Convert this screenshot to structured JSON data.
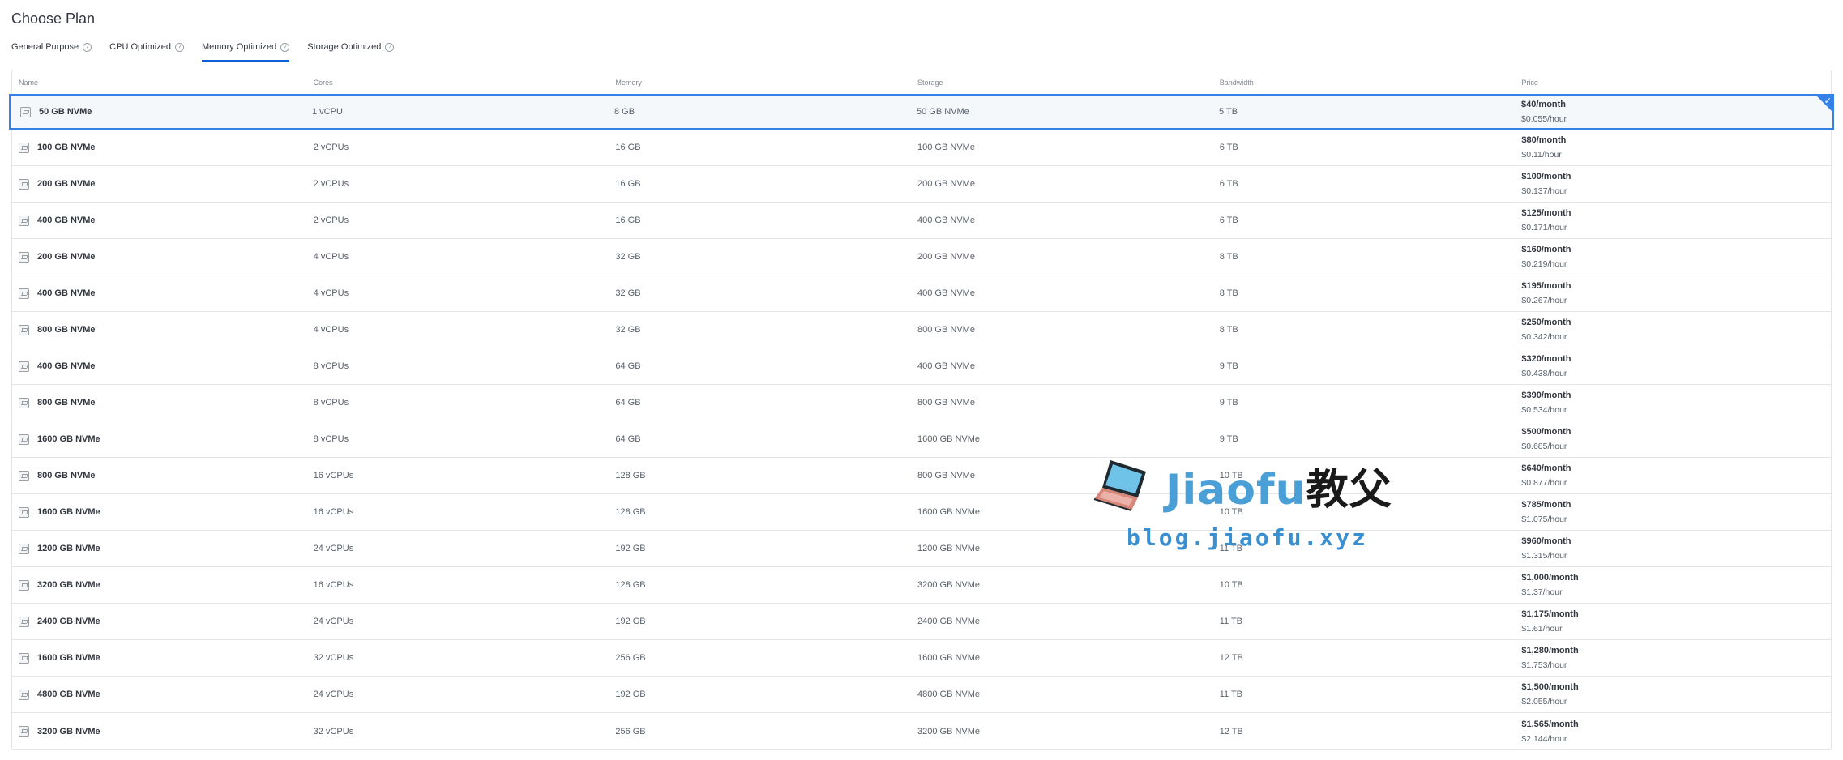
{
  "page": {
    "title": "Choose Plan"
  },
  "tabs": [
    {
      "label": "General Purpose",
      "active": false
    },
    {
      "label": "CPU Optimized",
      "active": false
    },
    {
      "label": "Memory Optimized",
      "active": true
    },
    {
      "label": "Storage Optimized",
      "active": false
    }
  ],
  "table": {
    "headers": {
      "name": "Name",
      "cores": "Cores",
      "memory": "Memory",
      "storage": "Storage",
      "bandwidth": "Bandwidth",
      "price": "Price"
    },
    "selected_index": 0,
    "rows": [
      {
        "name": "50 GB NVMe",
        "cores": "1 vCPU",
        "memory": "8 GB",
        "storage": "50 GB NVMe",
        "bandwidth": "5 TB",
        "price_month": "$40/month",
        "price_hour": "$0.055/hour"
      },
      {
        "name": "100 GB NVMe",
        "cores": "2 vCPUs",
        "memory": "16 GB",
        "storage": "100 GB NVMe",
        "bandwidth": "6 TB",
        "price_month": "$80/month",
        "price_hour": "$0.11/hour"
      },
      {
        "name": "200 GB NVMe",
        "cores": "2 vCPUs",
        "memory": "16 GB",
        "storage": "200 GB NVMe",
        "bandwidth": "6 TB",
        "price_month": "$100/month",
        "price_hour": "$0.137/hour"
      },
      {
        "name": "400 GB NVMe",
        "cores": "2 vCPUs",
        "memory": "16 GB",
        "storage": "400 GB NVMe",
        "bandwidth": "6 TB",
        "price_month": "$125/month",
        "price_hour": "$0.171/hour"
      },
      {
        "name": "200 GB NVMe",
        "cores": "4 vCPUs",
        "memory": "32 GB",
        "storage": "200 GB NVMe",
        "bandwidth": "8 TB",
        "price_month": "$160/month",
        "price_hour": "$0.219/hour"
      },
      {
        "name": "400 GB NVMe",
        "cores": "4 vCPUs",
        "memory": "32 GB",
        "storage": "400 GB NVMe",
        "bandwidth": "8 TB",
        "price_month": "$195/month",
        "price_hour": "$0.267/hour"
      },
      {
        "name": "800 GB NVMe",
        "cores": "4 vCPUs",
        "memory": "32 GB",
        "storage": "800 GB NVMe",
        "bandwidth": "8 TB",
        "price_month": "$250/month",
        "price_hour": "$0.342/hour"
      },
      {
        "name": "400 GB NVMe",
        "cores": "8 vCPUs",
        "memory": "64 GB",
        "storage": "400 GB NVMe",
        "bandwidth": "9 TB",
        "price_month": "$320/month",
        "price_hour": "$0.438/hour"
      },
      {
        "name": "800 GB NVMe",
        "cores": "8 vCPUs",
        "memory": "64 GB",
        "storage": "800 GB NVMe",
        "bandwidth": "9 TB",
        "price_month": "$390/month",
        "price_hour": "$0.534/hour"
      },
      {
        "name": "1600 GB NVMe",
        "cores": "8 vCPUs",
        "memory": "64 GB",
        "storage": "1600 GB NVMe",
        "bandwidth": "9 TB",
        "price_month": "$500/month",
        "price_hour": "$0.685/hour"
      },
      {
        "name": "800 GB NVMe",
        "cores": "16 vCPUs",
        "memory": "128 GB",
        "storage": "800 GB NVMe",
        "bandwidth": "10 TB",
        "price_month": "$640/month",
        "price_hour": "$0.877/hour"
      },
      {
        "name": "1600 GB NVMe",
        "cores": "16 vCPUs",
        "memory": "128 GB",
        "storage": "1600 GB NVMe",
        "bandwidth": "10 TB",
        "price_month": "$785/month",
        "price_hour": "$1.075/hour"
      },
      {
        "name": "1200 GB NVMe",
        "cores": "24 vCPUs",
        "memory": "192 GB",
        "storage": "1200 GB NVMe",
        "bandwidth": "11 TB",
        "price_month": "$960/month",
        "price_hour": "$1.315/hour"
      },
      {
        "name": "3200 GB NVMe",
        "cores": "16 vCPUs",
        "memory": "128 GB",
        "storage": "3200 GB NVMe",
        "bandwidth": "10 TB",
        "price_month": "$1,000/month",
        "price_hour": "$1.37/hour"
      },
      {
        "name": "2400 GB NVMe",
        "cores": "24 vCPUs",
        "memory": "192 GB",
        "storage": "2400 GB NVMe",
        "bandwidth": "11 TB",
        "price_month": "$1,175/month",
        "price_hour": "$1.61/hour"
      },
      {
        "name": "1600 GB NVMe",
        "cores": "32 vCPUs",
        "memory": "256 GB",
        "storage": "1600 GB NVMe",
        "bandwidth": "12 TB",
        "price_month": "$1,280/month",
        "price_hour": "$1.753/hour"
      },
      {
        "name": "4800 GB NVMe",
        "cores": "24 vCPUs",
        "memory": "192 GB",
        "storage": "4800 GB NVMe",
        "bandwidth": "11 TB",
        "price_month": "$1,500/month",
        "price_hour": "$2.055/hour"
      },
      {
        "name": "3200 GB NVMe",
        "cores": "32 vCPUs",
        "memory": "256 GB",
        "storage": "3200 GB NVMe",
        "bandwidth": "12 TB",
        "price_month": "$1,565/month",
        "price_hour": "$2.144/hour"
      }
    ]
  },
  "icons": {
    "help": "help-circle-icon",
    "plan": "server-icon",
    "selected": "checkmark-icon"
  },
  "colors": {
    "accent": "#3581e8",
    "selected_bg": "#f4f8fb",
    "tab_underline": "#0b5fd8"
  },
  "watermark": {
    "brand_latin": "Jiaofu",
    "brand_cn": "教父",
    "url": "blog.jiaofu.xyz"
  }
}
